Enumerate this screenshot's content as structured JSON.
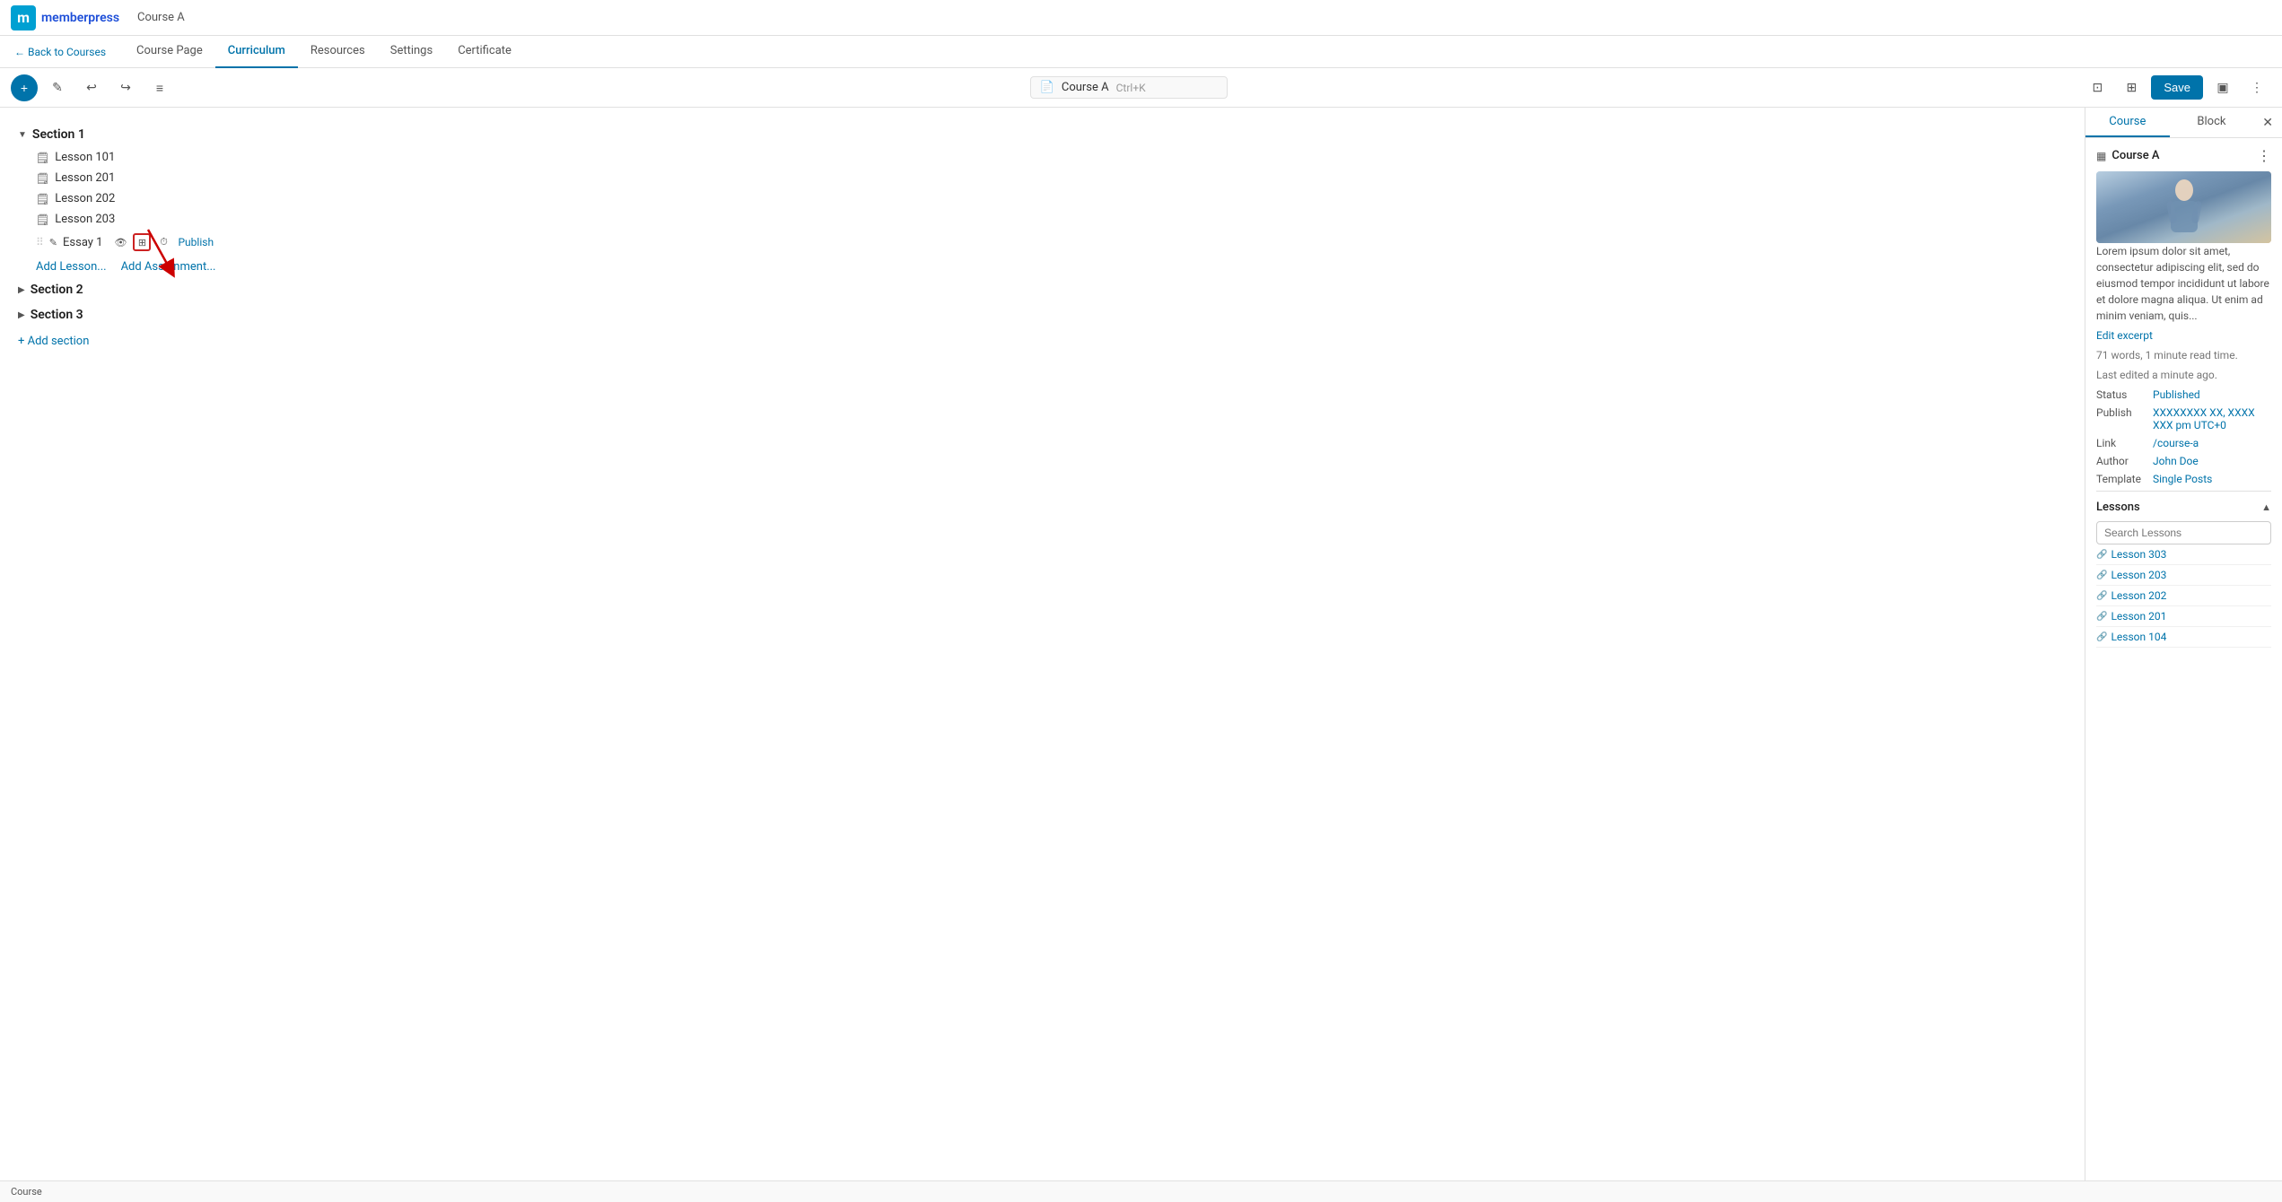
{
  "app": {
    "logo_letter": "m",
    "logo_brand": "memberpress",
    "course_name": "Course A"
  },
  "nav": {
    "back_label": "← Back to Courses",
    "tabs": [
      "Course Page",
      "Curriculum",
      "Resources",
      "Settings",
      "Certificate"
    ],
    "active_tab": "Curriculum"
  },
  "toolbar": {
    "plus_label": "+",
    "pencil_icon": "✎",
    "undo_icon": "↩",
    "redo_icon": "↪",
    "list_icon": "≡",
    "course_name": "Course A",
    "shortcut": "Ctrl+K",
    "preview_icon": "⊡",
    "external_icon": "⊞",
    "save_label": "Save",
    "view_icon": "▣",
    "more_icon": "⋮"
  },
  "curriculum": {
    "sections": [
      {
        "id": "section1",
        "name": "Section 1",
        "expanded": true,
        "lessons": [
          {
            "name": "Lesson 101"
          },
          {
            "name": "Lesson 201"
          },
          {
            "name": "Lesson 202"
          },
          {
            "name": "Lesson 203"
          }
        ],
        "essays": [
          {
            "name": "Essay 1",
            "publish_label": "Publish"
          }
        ],
        "add_lesson_label": "Add Lesson...",
        "add_assignment_label": "Add Assignment..."
      },
      {
        "id": "section2",
        "name": "Section 2",
        "expanded": false,
        "lessons": [],
        "essays": []
      },
      {
        "id": "section3",
        "name": "Section 3",
        "expanded": false,
        "lessons": [],
        "essays": []
      }
    ],
    "add_section_label": "+ Add section"
  },
  "right_panel": {
    "tabs": [
      "Course",
      "Block"
    ],
    "active_tab": "Course",
    "close_icon": "✕",
    "course": {
      "name": "Course A",
      "course_icon": "▦",
      "more_icon": "⋮",
      "description": "Lorem ipsum dolor sit amet, consectetur adipiscing elit, sed do eiusmod tempor incididunt ut labore et dolore magna aliqua. Ut enim ad minim veniam, quis...",
      "edit_excerpt_label": "Edit excerpt",
      "word_count": "71 words, 1 minute read time.",
      "last_edited": "Last edited a minute ago.",
      "status_label": "Status",
      "status_value": "Published",
      "publish_label": "Publish",
      "publish_value": "XXXXXXXX XX, XXXX XXX pm UTC+0",
      "link_label": "Link",
      "link_value": "/course-a",
      "author_label": "Author",
      "author_value": "John Doe",
      "template_label": "Template",
      "template_value": "Single Posts"
    },
    "lessons": {
      "title": "Lessons",
      "search_placeholder": "Search Lessons",
      "items": [
        {
          "name": "Lesson 303"
        },
        {
          "name": "Lesson 203"
        },
        {
          "name": "Lesson 202"
        },
        {
          "name": "Lesson 201"
        },
        {
          "name": "Lesson 104"
        }
      ]
    }
  },
  "status_bar": {
    "label": "Course"
  }
}
